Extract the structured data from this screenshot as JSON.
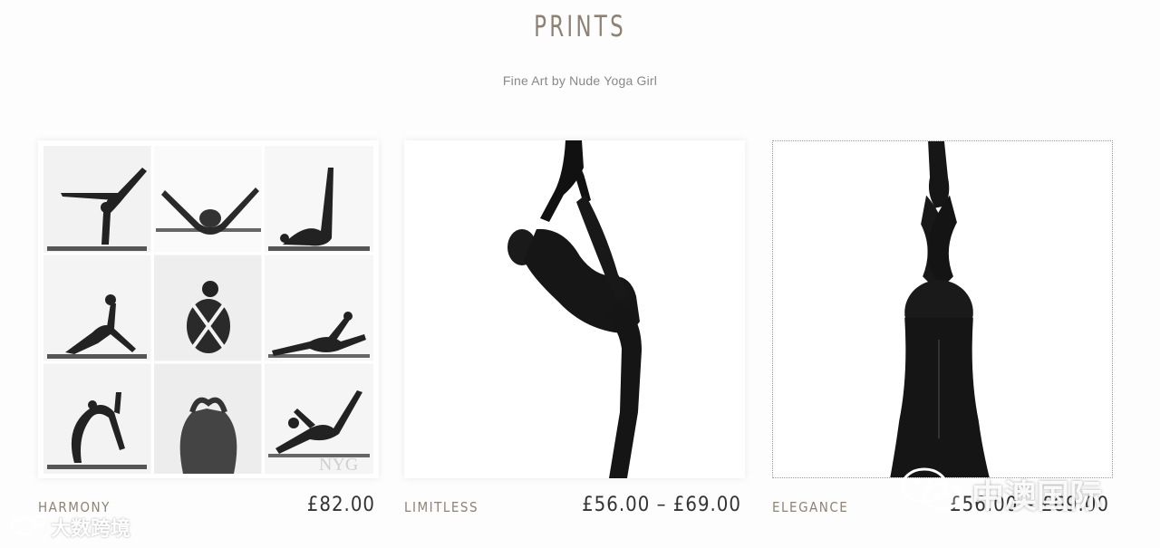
{
  "header": {
    "title": "PRINTS",
    "subtitle": "Fine Art by Nude Yoga Girl"
  },
  "products": [
    {
      "name": "HARMONY",
      "price": "£82.00",
      "image": "nine-pose-collage"
    },
    {
      "name": "LIMITLESS",
      "price": "£56.00 – £69.00",
      "image": "dancer-pose-silhouette"
    },
    {
      "name": "ELEGANCE",
      "price": "£56.00 – £69.00",
      "image": "headstand-silhouette"
    }
  ],
  "watermarks": {
    "left": "大数跨境",
    "right": "中澳国际"
  },
  "colors": {
    "accent": "#8e8274",
    "text": "#333333",
    "background": "#fdfdfd"
  }
}
